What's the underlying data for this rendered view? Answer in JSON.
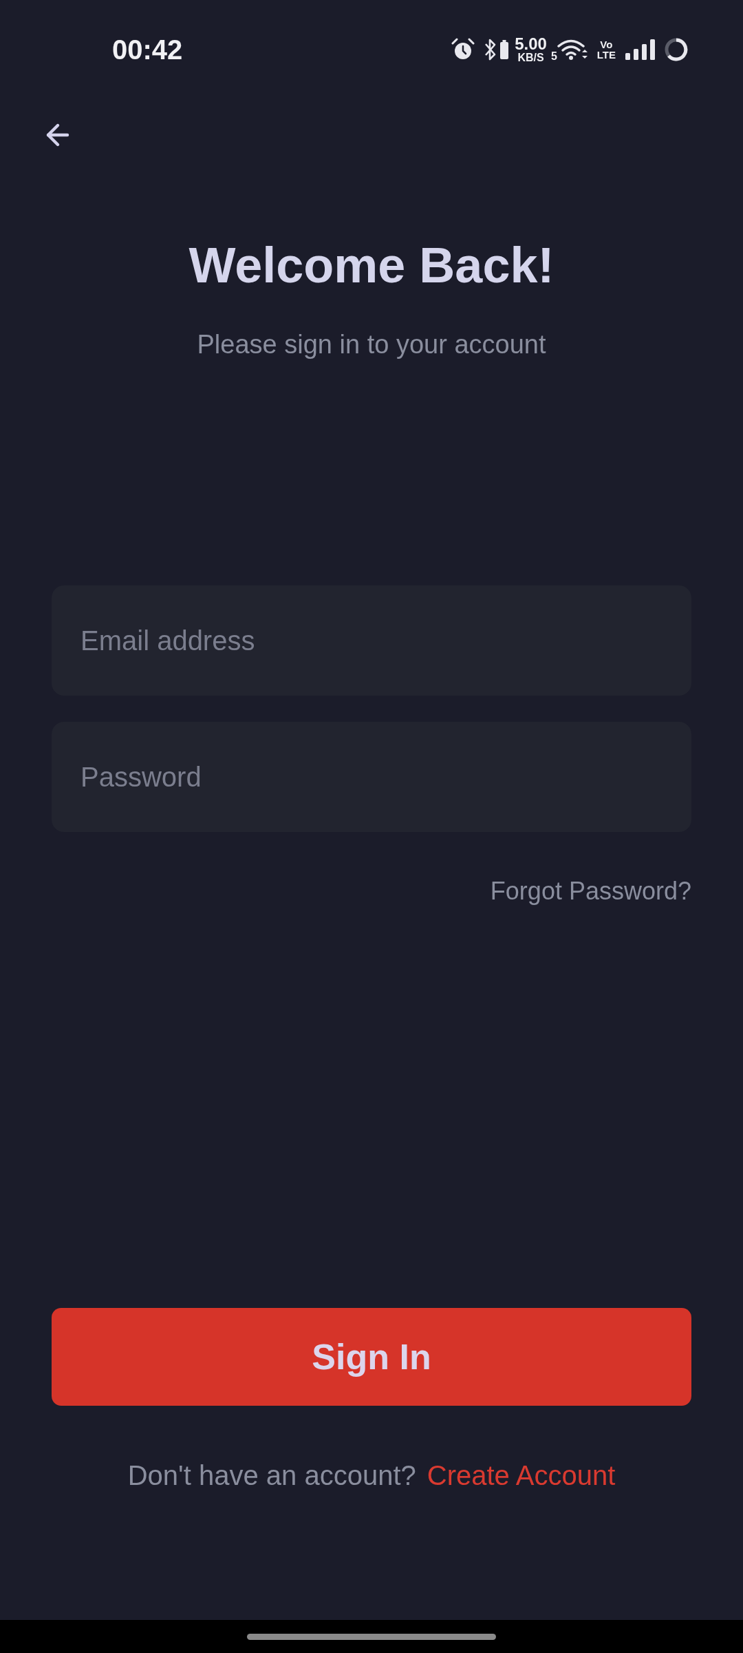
{
  "status_bar": {
    "time": "00:42",
    "network_speed": {
      "value": "5.00",
      "unit": "KB/S"
    },
    "wifi_band": "5",
    "volte": {
      "top": "Vo",
      "bottom": "LTE"
    }
  },
  "header": {
    "title": "Welcome Back!",
    "subtitle": "Please sign in to your account"
  },
  "form": {
    "fields": [
      {
        "placeholder": "Email address"
      },
      {
        "placeholder": "Password"
      }
    ],
    "forgot_link": "Forgot Password?"
  },
  "sign_in_button": {
    "label": "Sign In"
  },
  "footer": {
    "prompt": "Don't have an account?",
    "link": "Create Account"
  }
}
